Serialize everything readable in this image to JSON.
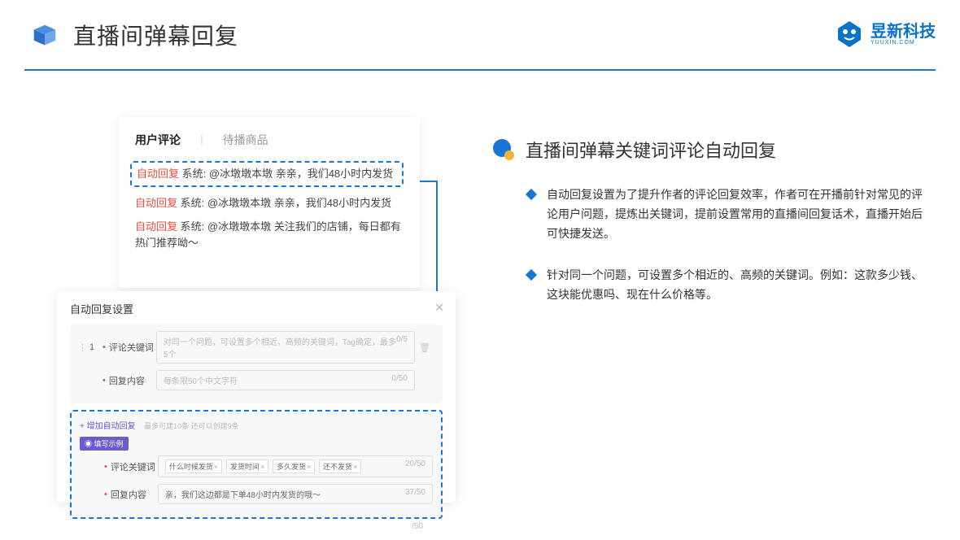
{
  "header": {
    "title": "直播间弹幕回复",
    "brand_name": "昱新科技",
    "brand_sub": "YUUXIN.COM"
  },
  "card1": {
    "tab_active": "用户评论",
    "tab_inactive": "待播商品",
    "auto_reply_tag": "自动回复",
    "system_prefix": "系统:",
    "msg1": "@冰墩墩本墩 亲亲，我们48小时内发货",
    "msg2": "@冰墩墩本墩 亲亲，我们48小时内发货",
    "msg3": "@冰墩墩本墩 关注我们的店铺，每日都有热门推荐呦～"
  },
  "card2": {
    "title": "自动回复设置",
    "row_num": "1",
    "label_keyword": "评论关键词",
    "placeholder_keyword": "对同一个问题，可设置多个相近、高频的关键词，Tag确定，最多5个",
    "count_keyword": "0/5",
    "label_content": "回复内容",
    "placeholder_content": "每条限50个中文字符",
    "count_content": "0/50",
    "add_link": "+ 增加自动回复",
    "add_hint": "最多可建10条 还可以创建9条",
    "example_badge": "◉ 填写示例",
    "ex_label_keyword": "评论关键词",
    "ex_tags": [
      "什么时候发货",
      "发货时间",
      "多久发货",
      "还不发货"
    ],
    "ex_count_keyword": "20/50",
    "ex_label_content": "回复内容",
    "ex_content": "亲，我们这边都是下单48小时内发货的哦～",
    "ex_count_content": "37/50",
    "outer_count": "/50"
  },
  "right": {
    "section_title": "直播间弹幕关键词评论自动回复",
    "bullet1": "自动回复设置为了提升作者的评论回复效率，作者可在开播前针对常见的评论用户问题，提炼出关键词，提前设置常用的直播间回复话术，直播开始后可快捷发送。",
    "bullet2": "针对同一个问题，可设置多个相近的、高频的关键词。例如：这款多少钱、这块能优惠吗、现在什么价格等。"
  }
}
